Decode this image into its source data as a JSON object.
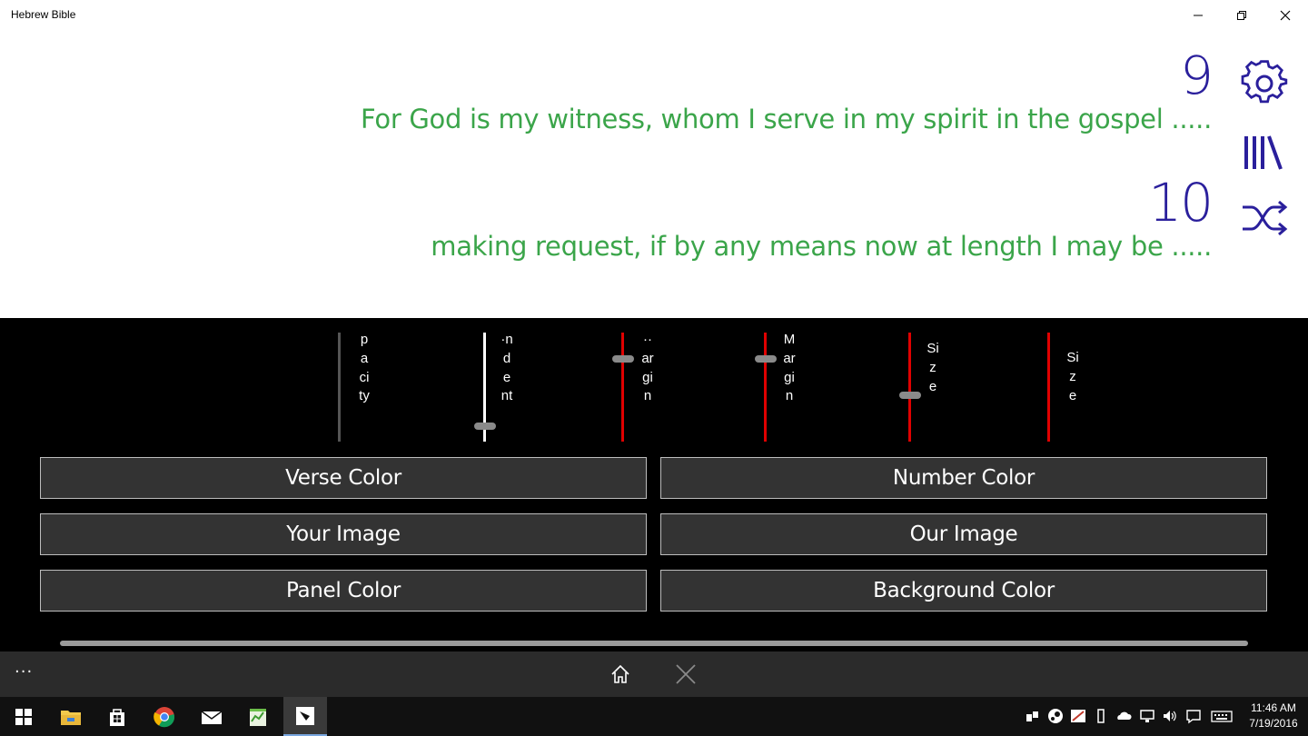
{
  "window": {
    "title": "Hebrew Bible"
  },
  "verses": [
    {
      "number": "9",
      "text": "For God is my witness, whom I serve in my spirit in the gospel ....."
    },
    {
      "number": "10",
      "text": "making request, if by any means now at length I may be ....."
    }
  ],
  "side_icons": [
    "gear-icon",
    "library-icon",
    "shuffle-icon"
  ],
  "sliders": [
    {
      "label": "pacity",
      "value": 0.0,
      "track_color": "#555555"
    },
    {
      "label": "·ndent",
      "value": 0.12,
      "track_color": "#ffffff"
    },
    {
      "label": "··argin",
      "value": 0.78,
      "track_color": "#e00000"
    },
    {
      "label": "Margin",
      "value": 0.78,
      "track_color": "#e00000"
    },
    {
      "label": "Size",
      "value": 0.42,
      "track_color": "#e00000"
    },
    {
      "label": "Size",
      "value": 0.0,
      "track_color": "#e00000"
    }
  ],
  "buttons": {
    "verse_color": "Verse Color",
    "number_color": "Number Color",
    "your_image": "Your Image",
    "our_image": "Our Image",
    "panel_color": "Panel Color",
    "background_color": "Background Color"
  },
  "appbar": {
    "more": "···"
  },
  "taskbar": {
    "apps": [
      "start-icon",
      "file-explorer-icon",
      "store-icon",
      "chrome-icon",
      "mail-icon",
      "notepad-icon",
      "hebrew-bible-icon"
    ],
    "time": "11:46 AM",
    "date": "7/19/2016"
  },
  "colors": {
    "verse_number": "#2a1f9c",
    "verse_text": "#3ba54a",
    "panel_bg": "#000000",
    "button_bg": "#333333"
  }
}
